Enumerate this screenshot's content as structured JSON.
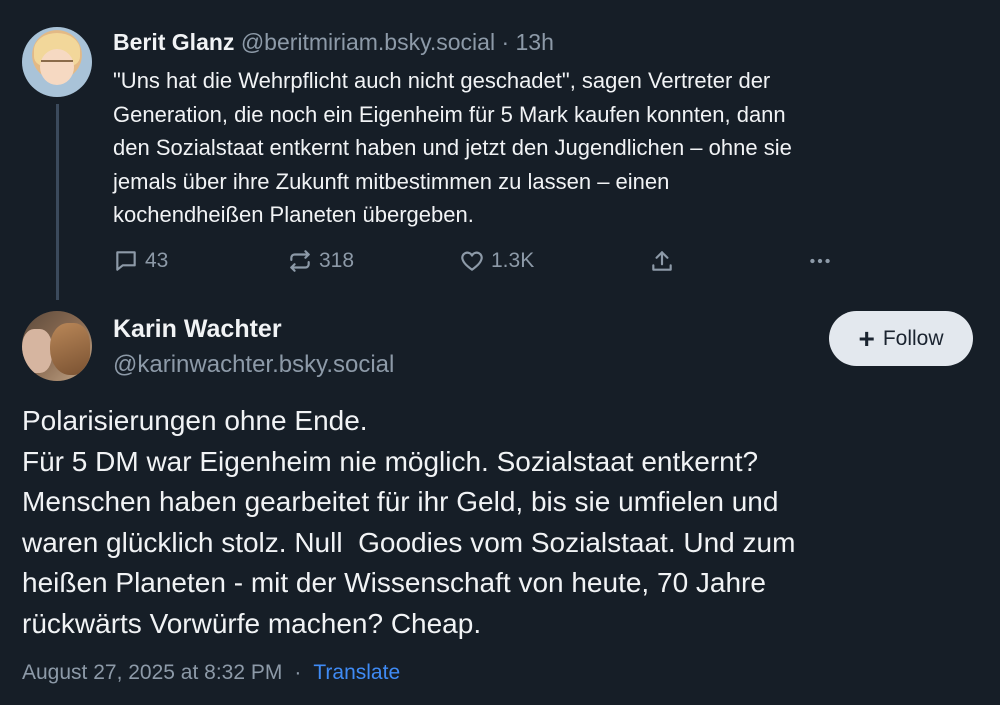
{
  "parent_post": {
    "display_name": "Berit Glanz",
    "handle": "@beritmiriam.bsky.social",
    "separator": "·",
    "time_ago": "13h",
    "text_lines": [
      "\"Uns hat die Wehrpflicht auch nicht geschadet\", sagen Vertreter der",
      "Generation, die noch ein Eigenheim für 5 Mark kaufen konnten, dann",
      "den Sozialstaat entkernt haben und jetzt den Jugendlichen – ohne sie",
      "jemals über ihre Zukunft mitbestimmen zu lassen – einen",
      "kochendheißen Planeten übergeben."
    ],
    "actions": {
      "replies": "43",
      "reposts": "318",
      "likes": "1.3K"
    },
    "avatar_icon": "user-avatar-child-photo"
  },
  "main_post": {
    "display_name": "Karin Wachter",
    "handle": "@karinwachter.bsky.social",
    "follow_label": "Follow",
    "avatar_icon": "user-avatar-dog-photo",
    "text_lines": [
      "Polarisierungen ohne Ende.",
      "Für 5 DM war Eigenheim nie möglich. Sozialstaat entkernt?",
      "Menschen haben gearbeitet für ihr Geld, bis sie umfielen und",
      "waren glücklich stolz. Null  Goodies vom Sozialstaat. Und zum",
      "heißen Planeten - mit der Wissenschaft von heute, 70 Jahre",
      "rückwärts Vorwürfe machen? Cheap."
    ],
    "timestamp": "August 27, 2025 at 8:32 PM",
    "separator": "·",
    "translate_label": "Translate"
  },
  "colors": {
    "background": "#161e27",
    "text": "#f1f3f5",
    "muted": "#8d9aa8",
    "link": "#3f8bf5",
    "thread_line": "#3b4a5c",
    "follow_bg": "#e3e8ee"
  }
}
